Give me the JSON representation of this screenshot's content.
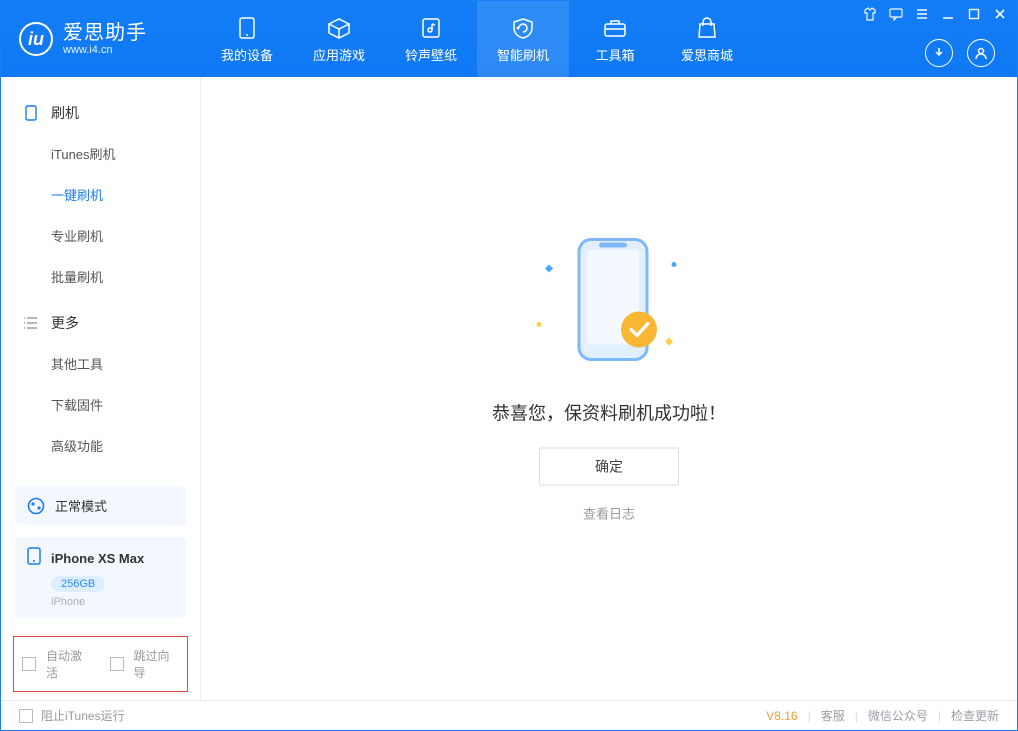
{
  "header": {
    "brand": {
      "title": "爱思助手",
      "url": "www.i4.cn"
    },
    "tabs": [
      {
        "label": "我的设备"
      },
      {
        "label": "应用游戏"
      },
      {
        "label": "铃声壁纸"
      },
      {
        "label": "智能刷机",
        "active": true
      },
      {
        "label": "工具箱"
      },
      {
        "label": "爱思商城"
      }
    ]
  },
  "sidebar": {
    "groups": [
      {
        "label": "刷机",
        "items": [
          {
            "label": "iTunes刷机"
          },
          {
            "label": "一键刷机",
            "active": true
          },
          {
            "label": "专业刷机"
          },
          {
            "label": "批量刷机"
          }
        ]
      },
      {
        "label": "更多",
        "items": [
          {
            "label": "其他工具"
          },
          {
            "label": "下载固件"
          },
          {
            "label": "高级功能"
          }
        ]
      }
    ],
    "mode": {
      "label": "正常模式"
    },
    "device": {
      "name": "iPhone XS Max",
      "capacity": "256GB",
      "type": "iPhone"
    },
    "foot": {
      "opt1": "自动激活",
      "opt2": "跳过向导"
    }
  },
  "main": {
    "success_message": "恭喜您，保资料刷机成功啦！",
    "confirm_label": "确定",
    "log_link": "查看日志"
  },
  "footer": {
    "block_itunes": "阻止iTunes运行",
    "version": "V8.16",
    "links": [
      "客服",
      "微信公众号",
      "检查更新"
    ]
  }
}
